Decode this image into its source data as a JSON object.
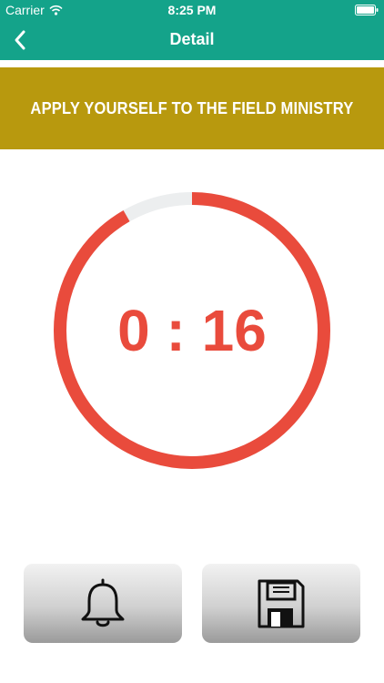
{
  "status_bar": {
    "carrier": "Carrier",
    "time": "8:25 PM",
    "icons": [
      "wifi-icon",
      "battery-icon"
    ]
  },
  "nav": {
    "title": "Detail",
    "back_icon": "chevron-left-icon"
  },
  "banner": {
    "text": "APPLY YOURSELF TO THE FIELD MINISTRY"
  },
  "timer": {
    "display": "0 : 16",
    "progress_fraction": 0.917,
    "colors": {
      "progress": "#e94b3c",
      "track": "#eceeef"
    }
  },
  "actions": {
    "reminder_icon": "bell-icon",
    "save_icon": "floppy-disk-icon"
  },
  "colors": {
    "nav": "#14a38a",
    "banner": "#b8990e"
  }
}
